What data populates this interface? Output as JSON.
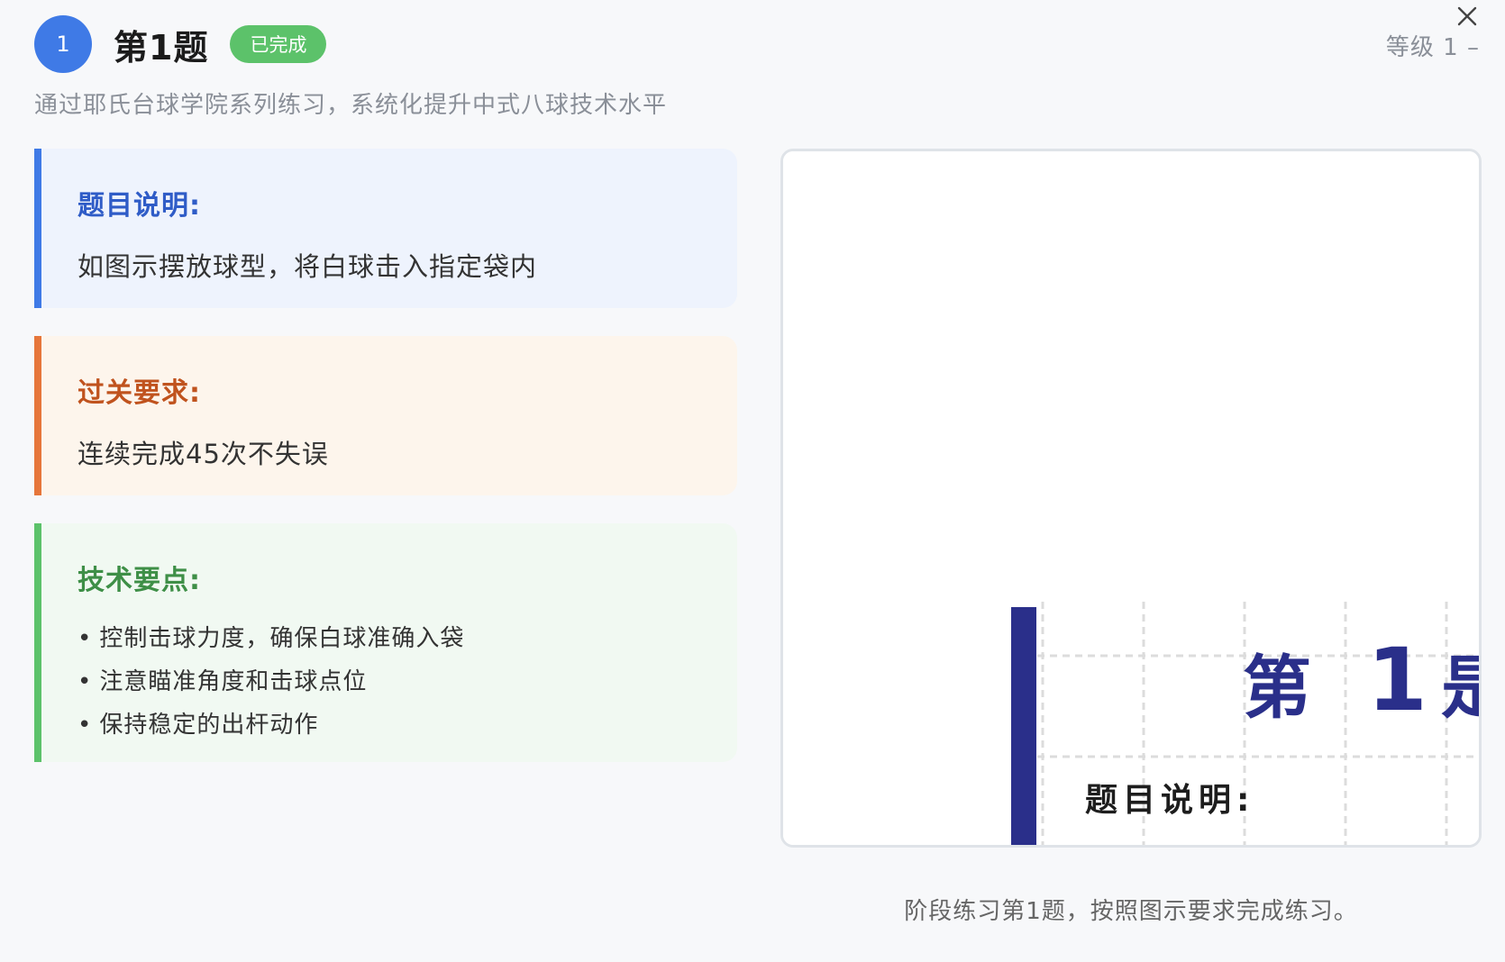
{
  "level": {
    "label": "等级 1 –"
  },
  "header": {
    "number": "1",
    "title": "第1题",
    "status_badge": "已完成",
    "subtitle": "通过耶氏台球学院系列练习，系统化提升中式八球技术水平"
  },
  "cards": {
    "description": {
      "title": "题目说明:",
      "body": "如图示摆放球型，将白球击入指定袋内"
    },
    "requirement": {
      "title": "过关要求:",
      "body": "连续完成45次不失误"
    },
    "tips": {
      "title": "技术要点:",
      "items": [
        "控制击球力度，确保白球准确入袋",
        "注意瞄准角度和击球点位",
        "保持稳定的出杆动作"
      ]
    }
  },
  "image": {
    "heading_chars": [
      "第",
      "1"
    ],
    "sub_label": "题目说明:",
    "bar_color": "#2a2f8a"
  },
  "caption": "阶段练习第1题，按照图示要求完成练习。",
  "colors": {
    "primary": "#3f7ae6",
    "success": "#5cc26a",
    "warning": "#e6763a"
  }
}
